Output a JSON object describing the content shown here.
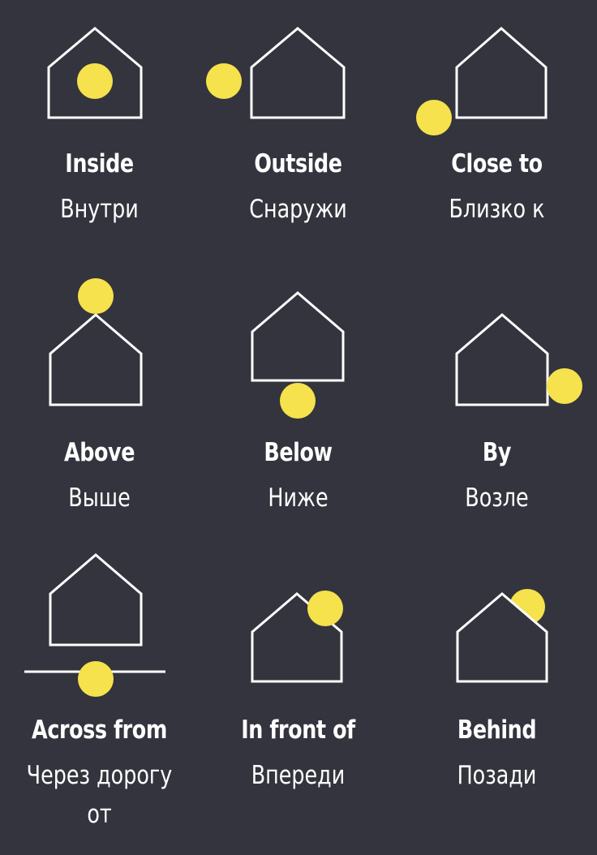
{
  "colors": {
    "background": "#33343d",
    "house_outline": "#ffffff",
    "dot": "#f5e24c",
    "text": "#ffffff"
  },
  "items": [
    {
      "icon": "house-with-dot-inside-icon",
      "english": "Inside",
      "russian": "Внутри"
    },
    {
      "icon": "house-with-dot-outside-icon",
      "english": "Outside",
      "russian": "Снаружи"
    },
    {
      "icon": "house-with-dot-close-to-icon",
      "english": "Close to",
      "russian": "Близко к"
    },
    {
      "icon": "house-with-dot-above-icon",
      "english": "Above",
      "russian": "Выше"
    },
    {
      "icon": "house-with-dot-below-icon",
      "english": "Below",
      "russian": "Ниже"
    },
    {
      "icon": "house-with-dot-by-icon",
      "english": "By",
      "russian": "Возле"
    },
    {
      "icon": "house-with-dot-across-from-icon",
      "english": "Across from",
      "russian": "Через дорогу",
      "russian_line2": "от"
    },
    {
      "icon": "house-with-dot-in-front-of-icon",
      "english": "In front of",
      "russian": "Впереди"
    },
    {
      "icon": "house-with-dot-behind-icon",
      "english": "Behind",
      "russian": "Позади"
    }
  ]
}
